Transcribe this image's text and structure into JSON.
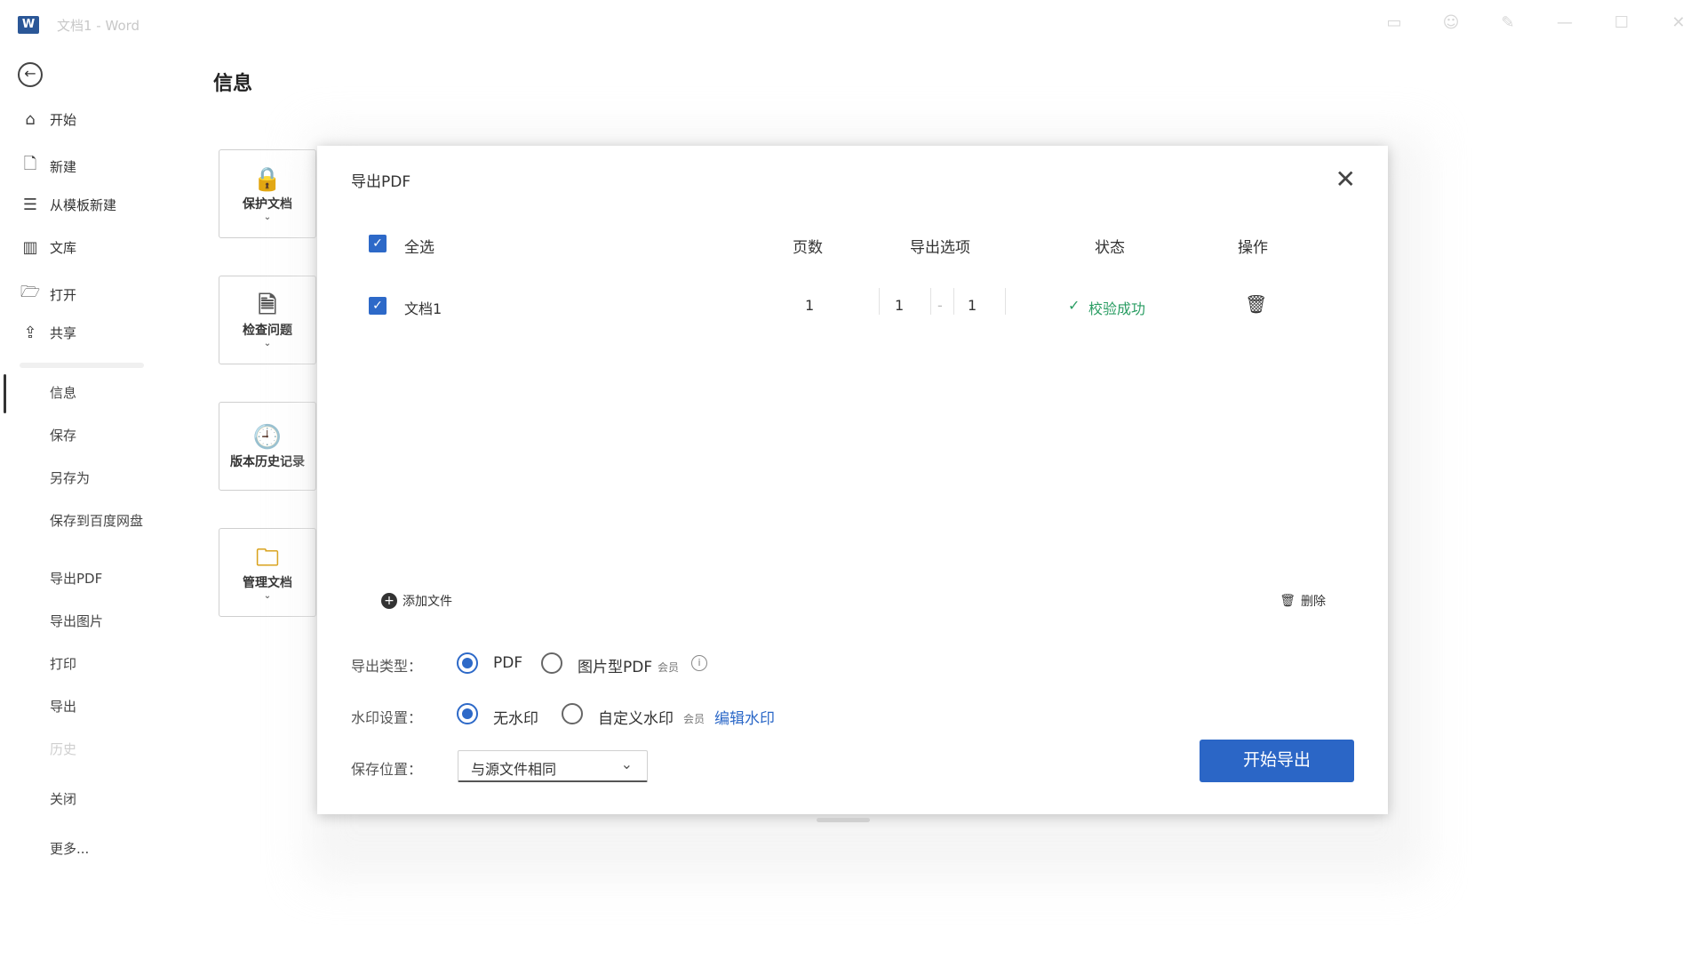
{
  "titlebar": {
    "app_icon": "W",
    "doc_title": "文档1 - Word",
    "icons": [
      "ribbon-icon",
      "account-icon",
      "pen-icon",
      "minimize-icon",
      "maximize-icon",
      "close-icon"
    ]
  },
  "nav": {
    "top": [
      {
        "label": "开始",
        "icon": "home-icon"
      },
      {
        "label": "新建",
        "icon": "new-document-icon"
      },
      {
        "label": "从模板新建",
        "icon": "template-icon"
      },
      {
        "label": "文库",
        "icon": "library-icon"
      },
      {
        "label": "打开",
        "icon": "folder-icon"
      },
      {
        "label": "共享",
        "icon": "share-icon"
      }
    ],
    "sub": {
      "info": "信息",
      "save": "保存",
      "save_as": "另存为",
      "save_to_baidu": "保存到百度网盘",
      "export_pdf": "导出PDF",
      "export_image": "导出图片",
      "print": "打印",
      "export": "导出",
      "faded": "历史",
      "close": "关闭",
      "more": "更多..."
    },
    "active": "信息"
  },
  "page": {
    "title": "信息"
  },
  "cards": [
    {
      "label": "保护文档",
      "icon": "lock-icon",
      "chevron": "⌄"
    },
    {
      "label": "检查问题",
      "icon": "inspect-document-icon",
      "chevron": "⌄"
    },
    {
      "label": "版本历史记录",
      "icon": "history-clock-icon",
      "chevron": ""
    },
    {
      "label": "管理文档",
      "icon": "manage-document-icon",
      "chevron": "⌄"
    }
  ],
  "dialog": {
    "title": "导出PDF",
    "close": "✕",
    "table": {
      "headers": {
        "select_all": "全选",
        "pages": "页数",
        "export_options": "导出选项",
        "status": "状态",
        "actions": "操作"
      },
      "rows": [
        {
          "checked": true,
          "name": "文档1",
          "pages": "1",
          "range_from": "1",
          "range_sep": "-",
          "range_to": "1",
          "status": "校验成功",
          "status_icon": "✓"
        }
      ]
    },
    "add_file": "添加文件",
    "delete": "删除",
    "export_type": {
      "label": "导出类型：",
      "options": [
        "PDF",
        "图片型PDF"
      ],
      "selected": "PDF",
      "vip_badge": "会员"
    },
    "watermark": {
      "label": "水印设置：",
      "options": [
        "无水印",
        "自定义水印"
      ],
      "selected": "无水印",
      "edit_link": "编辑水印"
    },
    "save_location": {
      "label": "保存位置：",
      "value": "与源文件相同"
    },
    "start_button": "开始导出"
  },
  "colors": {
    "accent": "#2b66c6",
    "success": "#2a9d63"
  }
}
